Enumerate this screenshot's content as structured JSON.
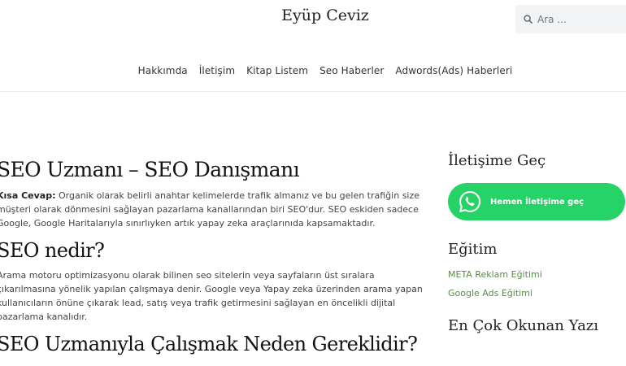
{
  "header": {
    "site_title": "Eyüp Ceviz",
    "search_placeholder": "Ara ..."
  },
  "nav": {
    "items": [
      "Hakkımda",
      "İletişim",
      "Kitap Listem",
      "Seo Haberler",
      "Adwords(Ads) Haberleri"
    ]
  },
  "main": {
    "h1": "SEO Uzmanı – SEO Danışmanı",
    "intro_label": "Kısa Cevap:",
    "intro_text": " Organik olarak belirli anahtar kelimelerde trafik almanız ve bu gelen trafiğin size müşteri olarak dönmesini sağlayan pazarlama kanallarından biri SEO'dur. SEO eskiden sadece Google, Google Haritalarıyla sınırlıyken artık yapay zeka araçlarınıda kapsamaktadır.",
    "h2_seo": "SEO nedir?",
    "seo_text": "Arama motoru optimizasyonu olarak bilinen seo sitelerin veya sayfaların üst sıralara çıkarılmasına yönelik yapılan çalışmaya denir. Google veya Yapay zeka üzerinden arama yapan kullanıcıların önüne çıkarak lead, satış veya trafik getirmesini sağlayan en öncelikli dijital pazarlama kanalıdır.",
    "h2_why": "SEO Uzmanıyla Çalışmak Neden Gereklidir?"
  },
  "sidebar": {
    "contact_title": "İletişime Geç",
    "whatsapp_label": "Hemen İletişime geç",
    "education_title": "Eğitim",
    "education_links": [
      "META Reklam Eğitimi",
      "Google Ads Eğitimi"
    ],
    "popular_title": "En Çok Okunan Yazı"
  },
  "colors": {
    "whatsapp_green": "#25d366",
    "link_green": "#5a8a4a"
  }
}
